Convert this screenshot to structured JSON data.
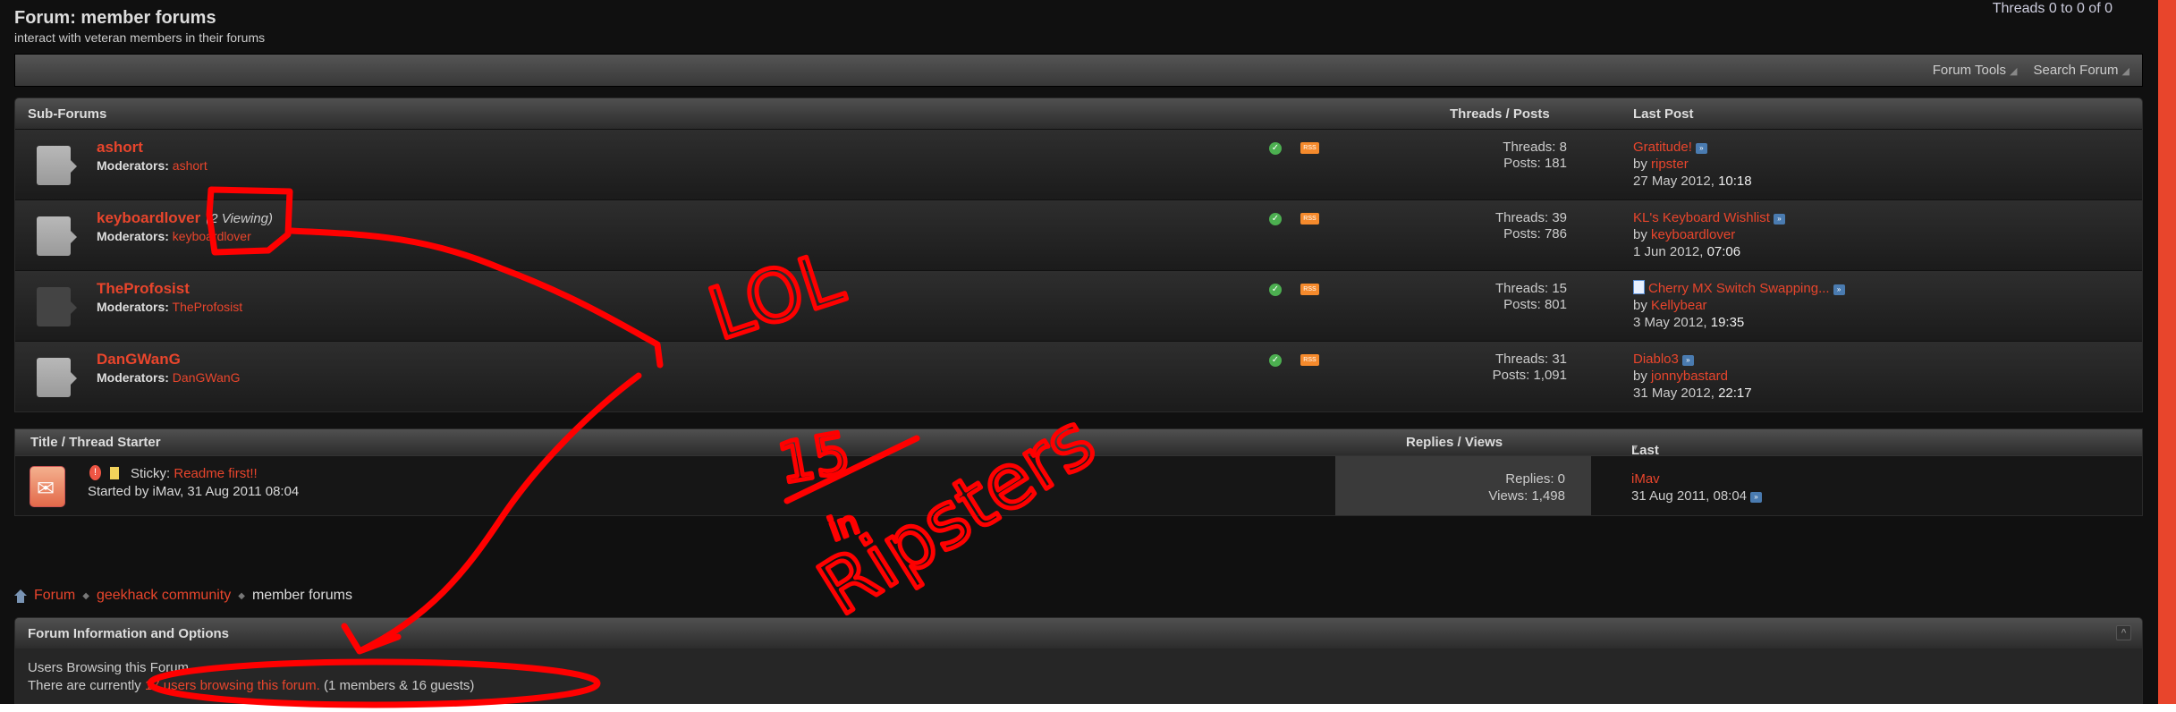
{
  "header": {
    "title": "Forum: member forums",
    "subtitle": "interact with veteran members in their forums",
    "page_count": "Threads 0 to 0 of 0"
  },
  "toolbar": {
    "forum_tools": "Forum Tools",
    "search_forum": "Search Forum"
  },
  "subforums": {
    "headers": {
      "name": "Sub-Forums",
      "stats": "Threads / Posts",
      "last_post": "Last Post"
    },
    "moderators_label": "Moderators:",
    "items": [
      {
        "name": "ashort",
        "viewing": "",
        "moderator": "ashort",
        "threads": "Threads: 8",
        "posts": "Posts: 181",
        "last_title": "Gratitude!",
        "by": "by",
        "last_user": "ripster",
        "last_date": "27 May 2012,",
        "last_time": "10:18",
        "has_doc_icon": false,
        "icon_active": true
      },
      {
        "name": "keyboardlover",
        "viewing": "(2 Viewing)",
        "moderator": "keyboardlover",
        "threads": "Threads: 39",
        "posts": "Posts: 786",
        "last_title": "KL's Keyboard Wishlist",
        "by": "by",
        "last_user": "keyboardlover",
        "last_date": "1 Jun 2012,",
        "last_time": "07:06",
        "has_doc_icon": false,
        "icon_active": true
      },
      {
        "name": "TheProfosist",
        "viewing": "",
        "moderator": "TheProfosist",
        "threads": "Threads: 15",
        "posts": "Posts: 801",
        "last_title": "Cherry MX Switch Swapping...",
        "by": "by",
        "last_user": "Kellybear",
        "last_date": "3 May 2012,",
        "last_time": "19:35",
        "has_doc_icon": true,
        "icon_active": false
      },
      {
        "name": "DanGWanG",
        "viewing": "",
        "moderator": "DanGWanG",
        "threads": "Threads: 31",
        "posts": "Posts: 1,091",
        "last_title": "Diablo3",
        "by": "by",
        "last_user": "jonnybastard",
        "last_date": "31 May 2012,",
        "last_time": "22:17",
        "has_doc_icon": false,
        "icon_active": true
      }
    ]
  },
  "threads": {
    "headers": {
      "title": "Title / Thread Starter",
      "replies": "Replies / Views",
      "last_post_by": "Last Post By"
    },
    "items": [
      {
        "prefix": "Sticky:",
        "title": "Readme first!!",
        "started": "Started by iMav, 31 Aug 2011 08:04",
        "replies": "Replies: 0",
        "views": "Views: 1,498",
        "last_user": "iMav",
        "last_date": "31 Aug 2011,",
        "last_time": "08:04"
      }
    ]
  },
  "breadcrumb": {
    "items": [
      "Forum",
      "geekhack community"
    ],
    "current": "member forums"
  },
  "info": {
    "title": "Forum Information and Options",
    "browsing_heading": "Users Browsing this Forum",
    "browsing_prefix": "There are currently",
    "browsing_link": "17 users browsing this forum.",
    "browsing_suffix": "(1 members & 16 guests)"
  },
  "annotation": {
    "lol": "LOL",
    "count": "15",
    "in": "in",
    "ripsters": "Ripsters"
  },
  "colors": {
    "link": "#e8452c",
    "annotation": "#ff0000",
    "background": "#101010"
  }
}
